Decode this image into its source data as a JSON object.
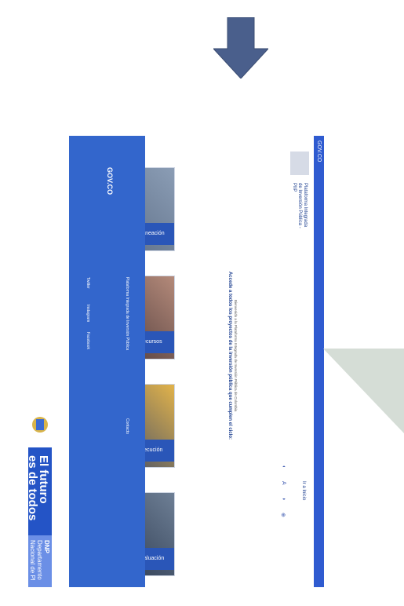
{
  "govbar": {
    "label": "GOV.CO"
  },
  "header": {
    "title": "Plataforma Integrada de Inversión Pública - PIIP",
    "right_link": "Ir a Inicio"
  },
  "toolbar": {
    "icons": [
      "accessibility-icon",
      "font-size-icon",
      "contrast-icon",
      "zoom-icon"
    ]
  },
  "intro": {
    "subtitle": "Bienvenido a la Plataforma Integrada de Inversión Pública de Colombia",
    "heading": "Accede a todos los proyectos de la inversión pública que cumplen el ciclo:"
  },
  "cards": [
    {
      "label": "Planeación"
    },
    {
      "label": "Recursos"
    },
    {
      "label": "Ejecución"
    },
    {
      "label": "Evaluación"
    }
  ],
  "footer": {
    "brand": "GOV.CO",
    "platform_title": "Plataforma Integrada de Inversión Pública",
    "contact_title": "Contacto",
    "social": [
      "Twitter",
      "Instagram",
      "Facebook"
    ]
  },
  "thumbnail": {
    "slogan_line1": "El futuro",
    "slogan_line2": "es de todos",
    "dnp_line1": "DNP",
    "dnp_line2": "Departamento",
    "dnp_line3": "Nacional de Pl"
  },
  "colors": {
    "primary_blue": "#3366cc",
    "arrow": "#4a5f8c",
    "triangle": "#d5ddd6"
  }
}
